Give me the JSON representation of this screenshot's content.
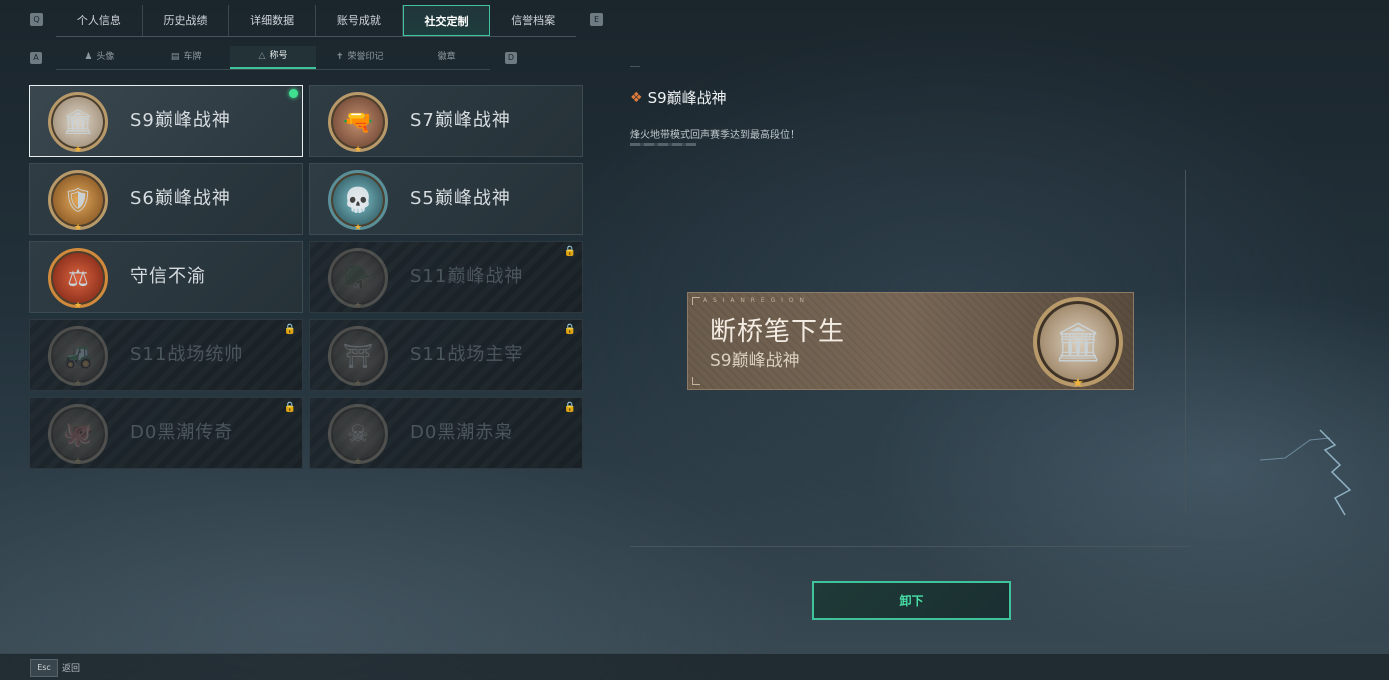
{
  "main_tabs": {
    "left_key": "Q",
    "right_key": "E",
    "items": [
      "个人信息",
      "历史战绩",
      "详细数据",
      "账号成就",
      "社交定制",
      "信誉档案"
    ],
    "active_index": 4
  },
  "sub_tabs": {
    "left_key": "A",
    "right_key": "D",
    "items": [
      {
        "label": "头像",
        "icon": "user-icon"
      },
      {
        "label": "车牌",
        "icon": "plate-icon"
      },
      {
        "label": "称号",
        "icon": "title-icon"
      },
      {
        "label": "荣誉印记",
        "icon": "emblem-icon"
      },
      {
        "label": "徽章",
        "icon": ""
      }
    ],
    "active_index": 2
  },
  "cards": [
    {
      "title": "S9巅峰战神",
      "locked": false,
      "selected": true,
      "equipped": true,
      "glyph": "🏛"
    },
    {
      "title": "S7巅峰战神",
      "locked": false,
      "selected": false,
      "equipped": false,
      "glyph": "🔫"
    },
    {
      "title": "S6巅峰战神",
      "locked": false,
      "selected": false,
      "equipped": false,
      "glyph": "🛡"
    },
    {
      "title": "S5巅峰战神",
      "locked": false,
      "selected": false,
      "equipped": false,
      "glyph": "💀"
    },
    {
      "title": "守信不渝",
      "locked": false,
      "selected": false,
      "equipped": false,
      "glyph": "⚖"
    },
    {
      "title": "S11巅峰战神",
      "locked": true,
      "selected": false,
      "equipped": false,
      "glyph": "🪖"
    },
    {
      "title": "S11战场统帅",
      "locked": true,
      "selected": false,
      "equipped": false,
      "glyph": "🚜"
    },
    {
      "title": "S11战场主宰",
      "locked": true,
      "selected": false,
      "equipped": false,
      "glyph": "⛩"
    },
    {
      "title": "D0黑潮传奇",
      "locked": true,
      "selected": false,
      "equipped": false,
      "glyph": "🐙"
    },
    {
      "title": "D0黑潮赤枭",
      "locked": true,
      "selected": false,
      "equipped": false,
      "glyph": "☠"
    }
  ],
  "detail": {
    "title": "S9巅峰战神",
    "description": "烽火地带模式回声赛季达到最高段位！",
    "nameplate": {
      "small_text": "A S I A N   R E G I O N",
      "player_name": "断桥笔下生",
      "title": "S9巅峰战神"
    },
    "unequip_label": "卸下"
  },
  "footer": {
    "esc_key": "Esc",
    "back_label": "返回"
  },
  "colors": {
    "accent": "#3fc39a",
    "equipped_dot": "#3fe08f",
    "badge_ring": "#b89a6a",
    "star": "#f0b33c"
  }
}
